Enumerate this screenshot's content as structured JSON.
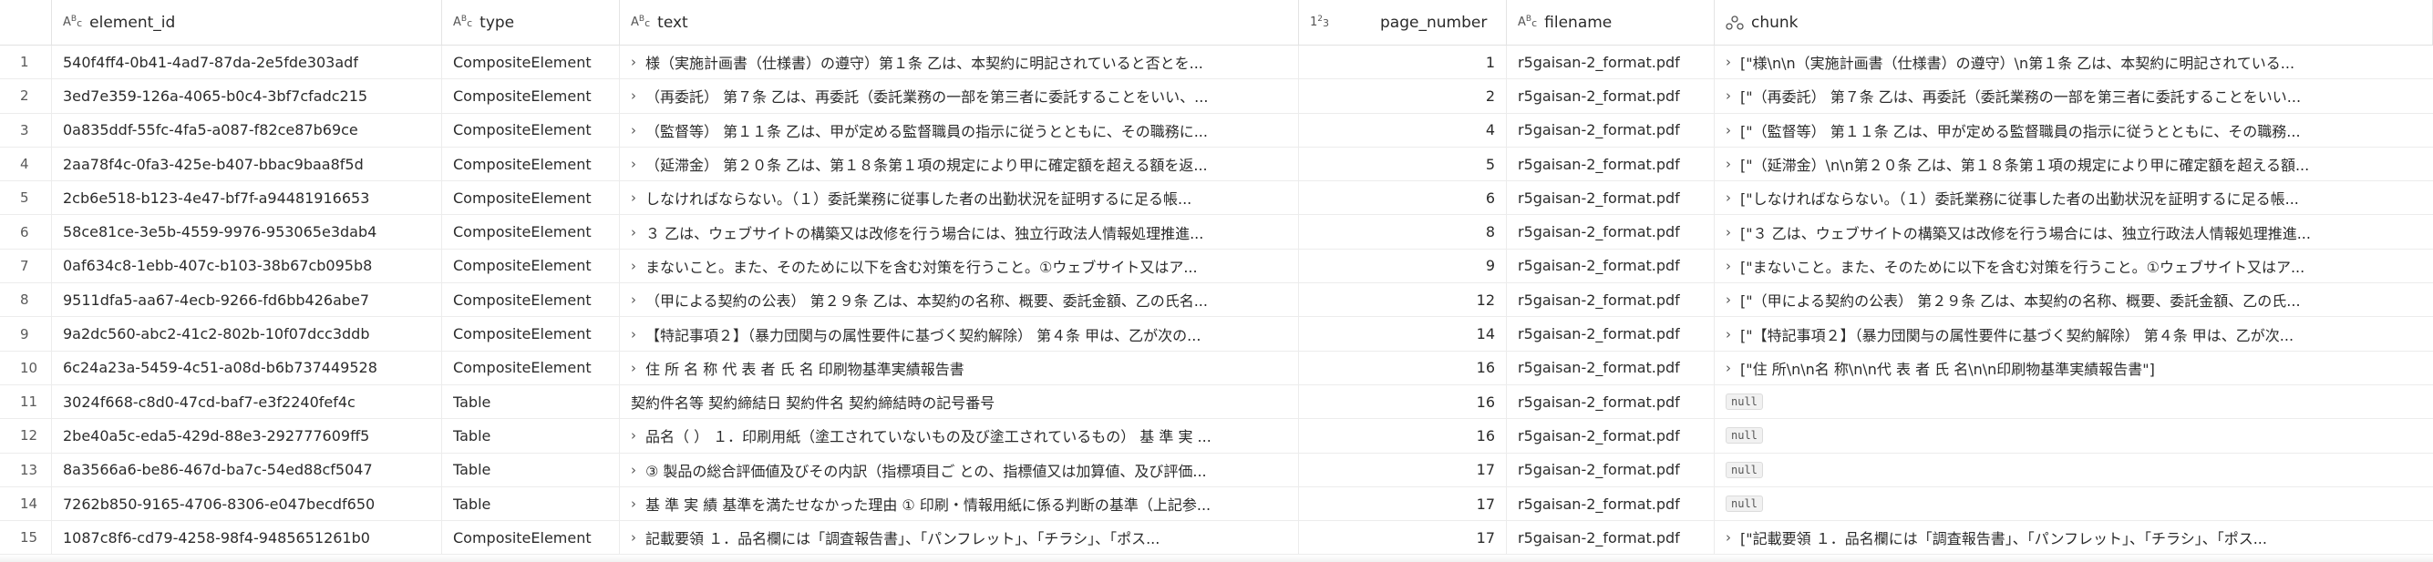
{
  "columns": {
    "element_id": "element_id",
    "type": "type",
    "text": "text",
    "page_number": "page_number",
    "filename": "filename",
    "chunk": "chunk"
  },
  "type_icons": {
    "string": "ABc",
    "number": "123",
    "struct": "struct-icon"
  },
  "rows": [
    {
      "idx": "1",
      "element_id": "540f4ff4-0b41-4ad7-87da-2e5fde303adf",
      "type": "CompositeElement",
      "text": "様（実施計画書（仕様書）の遵守）第１条 乙は、本契約に明記されていると否とを...",
      "page_number": "1",
      "filename": "r5gaisan-2_format.pdf",
      "chunk": "[\"様\\n\\n（実施計画書（仕様書）の遵守）\\n第１条 乙は、本契約に明記されている..."
    },
    {
      "idx": "2",
      "element_id": "3ed7e359-126a-4065-b0c4-3bf7cfadc215",
      "type": "CompositeElement",
      "text": "（再委託） 第７条 乙は、再委託（委託業務の一部を第三者に委託することをいい、...",
      "page_number": "2",
      "filename": "r5gaisan-2_format.pdf",
      "chunk": "[\"（再委託） 第７条 乙は、再委託（委託業務の一部を第三者に委託することをいい..."
    },
    {
      "idx": "3",
      "element_id": "0a835ddf-55fc-4fa5-a087-f82ce87b69ce",
      "type": "CompositeElement",
      "text": "（監督等） 第１１条 乙は、甲が定める監督職員の指示に従うとともに、その職務に...",
      "page_number": "4",
      "filename": "r5gaisan-2_format.pdf",
      "chunk": "[\"（監督等） 第１１条 乙は、甲が定める監督職員の指示に従うとともに、その職務..."
    },
    {
      "idx": "4",
      "element_id": "2aa78f4c-0fa3-425e-b407-bbac9baa8f5d",
      "type": "CompositeElement",
      "text": "（延滞金） 第２０条 乙は、第１８条第１項の規定により甲に確定額を超える額を返...",
      "page_number": "5",
      "filename": "r5gaisan-2_format.pdf",
      "chunk": "[\"（延滞金）\\n\\n第２０条 乙は、第１８条第１項の規定により甲に確定額を超える額..."
    },
    {
      "idx": "5",
      "element_id": "2cb6e518-b123-4e47-bf7f-a94481916653",
      "type": "CompositeElement",
      "text": "しなければならない。（１）委託業務に従事した者の出勤状況を証明するに足る帳...",
      "page_number": "6",
      "filename": "r5gaisan-2_format.pdf",
      "chunk": "[\"しなければならない。（１）委託業務に従事した者の出勤状況を証明するに足る帳..."
    },
    {
      "idx": "6",
      "element_id": "58ce81ce-3e5b-4559-9976-953065e3dab4",
      "type": "CompositeElement",
      "text": "３ 乙は、ウェブサイトの構築又は改修を行う場合には、独立行政法人情報処理推進...",
      "page_number": "8",
      "filename": "r5gaisan-2_format.pdf",
      "chunk": "[\"３ 乙は、ウェブサイトの構築又は改修を行う場合には、独立行政法人情報処理推進..."
    },
    {
      "idx": "7",
      "element_id": "0af634c8-1ebb-407c-b103-38b67cb095b8",
      "type": "CompositeElement",
      "text": "まないこと。また、そのために以下を含む対策を行うこと。①ウェブサイト又はア...",
      "page_number": "9",
      "filename": "r5gaisan-2_format.pdf",
      "chunk": "[\"まないこと。また、そのために以下を含む対策を行うこと。①ウェブサイト又はア..."
    },
    {
      "idx": "8",
      "element_id": "9511dfa5-aa67-4ecb-9266-fd6bb426abe7",
      "type": "CompositeElement",
      "text": "（甲による契約の公表） 第２９条 乙は、本契約の名称、概要、委託金額、乙の氏名...",
      "page_number": "12",
      "filename": "r5gaisan-2_format.pdf",
      "chunk": "[\"（甲による契約の公表） 第２９条 乙は、本契約の名称、概要、委託金額、乙の氏..."
    },
    {
      "idx": "9",
      "element_id": "9a2dc560-abc2-41c2-802b-10f07dcc3ddb",
      "type": "CompositeElement",
      "text": "【特記事項２】（暴力団関与の属性要件に基づく契約解除） 第４条 甲は、乙が次の...",
      "page_number": "14",
      "filename": "r5gaisan-2_format.pdf",
      "chunk": "[\"【特記事項２】（暴力団関与の属性要件に基づく契約解除） 第４条 甲は、乙が次..."
    },
    {
      "idx": "10",
      "element_id": "6c24a23a-5459-4c51-a08d-b6b737449528",
      "type": "CompositeElement",
      "text": "住 所 名 称 代 表 者 氏 名 印刷物基準実績報告書",
      "page_number": "16",
      "filename": "r5gaisan-2_format.pdf",
      "chunk": "[\"住 所\\n\\n名 称\\n\\n代 表 者 氏 名\\n\\n印刷物基準実績報告書\"]"
    },
    {
      "idx": "11",
      "element_id": "3024f668-c8d0-47cd-baf7-e3f2240fef4c",
      "type": "Table",
      "text": "契約件名等 契約締結日 契約件名 契約締結時の記号番号",
      "page_number": "16",
      "filename": "r5gaisan-2_format.pdf",
      "chunk": null
    },
    {
      "idx": "12",
      "element_id": "2be40a5c-eda5-429d-88e3-292777609ff5",
      "type": "Table",
      "text": "品名（ ） １．印刷用紙（塗工されていないもの及び塗工されているもの） 基 準 実 ...",
      "page_number": "16",
      "filename": "r5gaisan-2_format.pdf",
      "chunk": null
    },
    {
      "idx": "13",
      "element_id": "8a3566a6-be86-467d-ba7c-54ed88cf5047",
      "type": "Table",
      "text": "③ 製品の総合評価値及びその内訳（指標項目ご との、指標値又は加算値、及び評価...",
      "page_number": "17",
      "filename": "r5gaisan-2_format.pdf",
      "chunk": null
    },
    {
      "idx": "14",
      "element_id": "7262b850-9165-4706-8306-e047becdf650",
      "type": "Table",
      "text": "基 準 実 績 基準を満たせなかった理由 ① 印刷・情報用紙に係る判断の基準（上記参...",
      "page_number": "17",
      "filename": "r5gaisan-2_format.pdf",
      "chunk": null
    },
    {
      "idx": "15",
      "element_id": "1087c8f6-cd79-4258-98f4-9485651261b0",
      "type": "CompositeElement",
      "text": "記載要領 １．品名欄には「調査報告書」、「パンフレット」、「チラシ」、「ポス...",
      "page_number": "17",
      "filename": "r5gaisan-2_format.pdf",
      "chunk": "[\"記載要領 １．品名欄には「調査報告書」、「パンフレット」、「チラシ」、「ポス..."
    }
  ],
  "text_has_caret": [
    true,
    true,
    true,
    true,
    true,
    true,
    true,
    true,
    true,
    true,
    false,
    true,
    true,
    true,
    true
  ],
  "null_label": "null"
}
